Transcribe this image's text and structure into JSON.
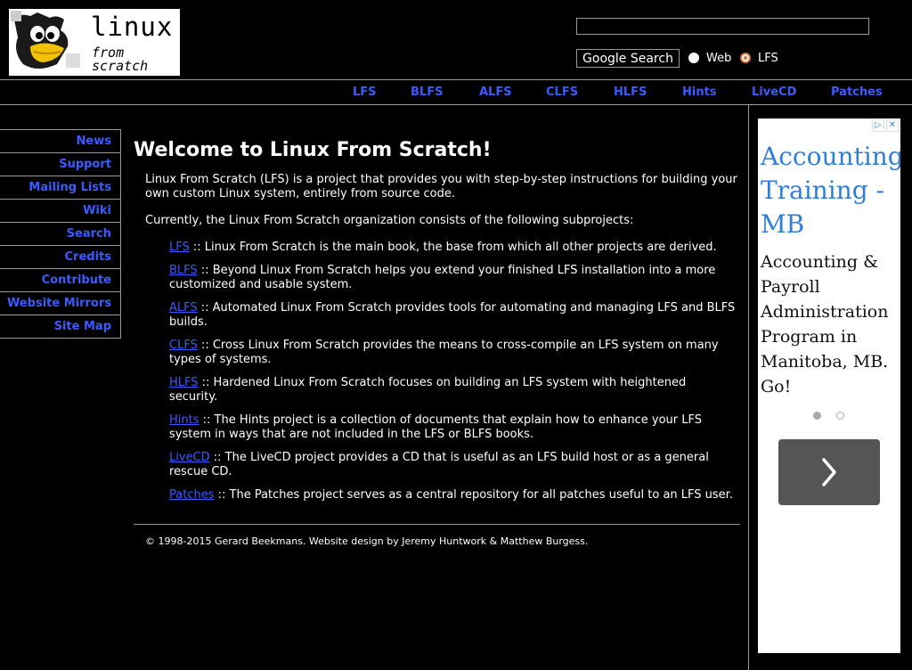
{
  "header": {
    "logo": {
      "line1": "linux",
      "line2": "from scratch"
    },
    "search": {
      "button_label": "Google Search",
      "radio_web": "Web",
      "radio_lfs": "LFS",
      "selected": "LFS"
    }
  },
  "topnav": [
    "LFS",
    "BLFS",
    "ALFS",
    "CLFS",
    "HLFS",
    "Hints",
    "LiveCD",
    "Patches"
  ],
  "sidebar": [
    "News",
    "Support",
    "Mailing Lists",
    "Wiki",
    "Search",
    "Credits",
    "Contribute",
    "Website Mirrors",
    "Site Map"
  ],
  "main": {
    "title": "Welcome to Linux From Scratch!",
    "intro": "Linux From Scratch (LFS) is a project that provides you with step-by-step instructions for building your own custom Linux system, entirely from source code.",
    "subprojects_intro": "Currently, the Linux From Scratch organization consists of the following subprojects:",
    "projects": [
      {
        "name": "LFS",
        "desc": " :: Linux From Scratch is the main book, the base from which all other projects are derived."
      },
      {
        "name": "BLFS",
        "desc": " :: Beyond Linux From Scratch helps you extend your finished LFS installation into a more customized and usable system."
      },
      {
        "name": "ALFS",
        "desc": " :: Automated Linux From Scratch provides tools for automating and managing LFS and BLFS builds."
      },
      {
        "name": "CLFS",
        "desc": " :: Cross Linux From Scratch provides the means to cross-compile an LFS system on many types of systems."
      },
      {
        "name": "HLFS",
        "desc": " :: Hardened Linux From Scratch focuses on building an LFS system with heightened security."
      },
      {
        "name": "Hints",
        "desc": " :: The Hints project is a collection of documents that explain how to enhance your LFS system in ways that are not included in the LFS or BLFS books."
      },
      {
        "name": "LiveCD",
        "desc": " :: The LiveCD project provides a CD that is useful as an LFS build host or as a general rescue CD."
      },
      {
        "name": "Patches",
        "desc": " :: The Patches project serves as a central repository for all patches useful to an LFS user."
      }
    ],
    "footer": "© 1998-2015 Gerard Beekmans. Website design by Jeremy Huntwork & Matthew Burgess."
  },
  "ad": {
    "headline": "Accounting Training - MB",
    "body": "Accounting & Payroll Administration Program in Manitoba, MB. Go!",
    "icons": {
      "adchoices": "info-icon",
      "close": "close-icon",
      "next": "chevron-right-icon"
    },
    "slides": 2,
    "active_slide": 1
  },
  "colors": {
    "background": "#000000",
    "link": "#3a5cff",
    "ad_headline": "#2f7fd6",
    "radio_selected": "#e0773a"
  }
}
